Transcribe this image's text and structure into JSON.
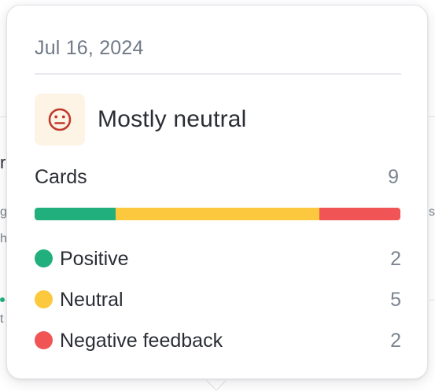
{
  "tooltip": {
    "date": "Jul 16, 2024",
    "mood": {
      "icon": "neutral-face-icon",
      "label": "Mostly neutral",
      "icon_color": "#c0392b",
      "icon_bg": "#fdf4e6"
    },
    "cards": {
      "label": "Cards",
      "count": "9"
    },
    "breakdown": [
      {
        "label": "Positive",
        "value": "2",
        "count": 2,
        "color": "#21b07d"
      },
      {
        "label": "Neutral",
        "value": "5",
        "count": 5,
        "color": "#fcc83d"
      },
      {
        "label": "Negative feedback",
        "value": "2",
        "count": 2,
        "color": "#f05454"
      }
    ]
  },
  "background": {
    "glyphs": [
      "r",
      "g",
      "h",
      "s",
      "t"
    ]
  }
}
